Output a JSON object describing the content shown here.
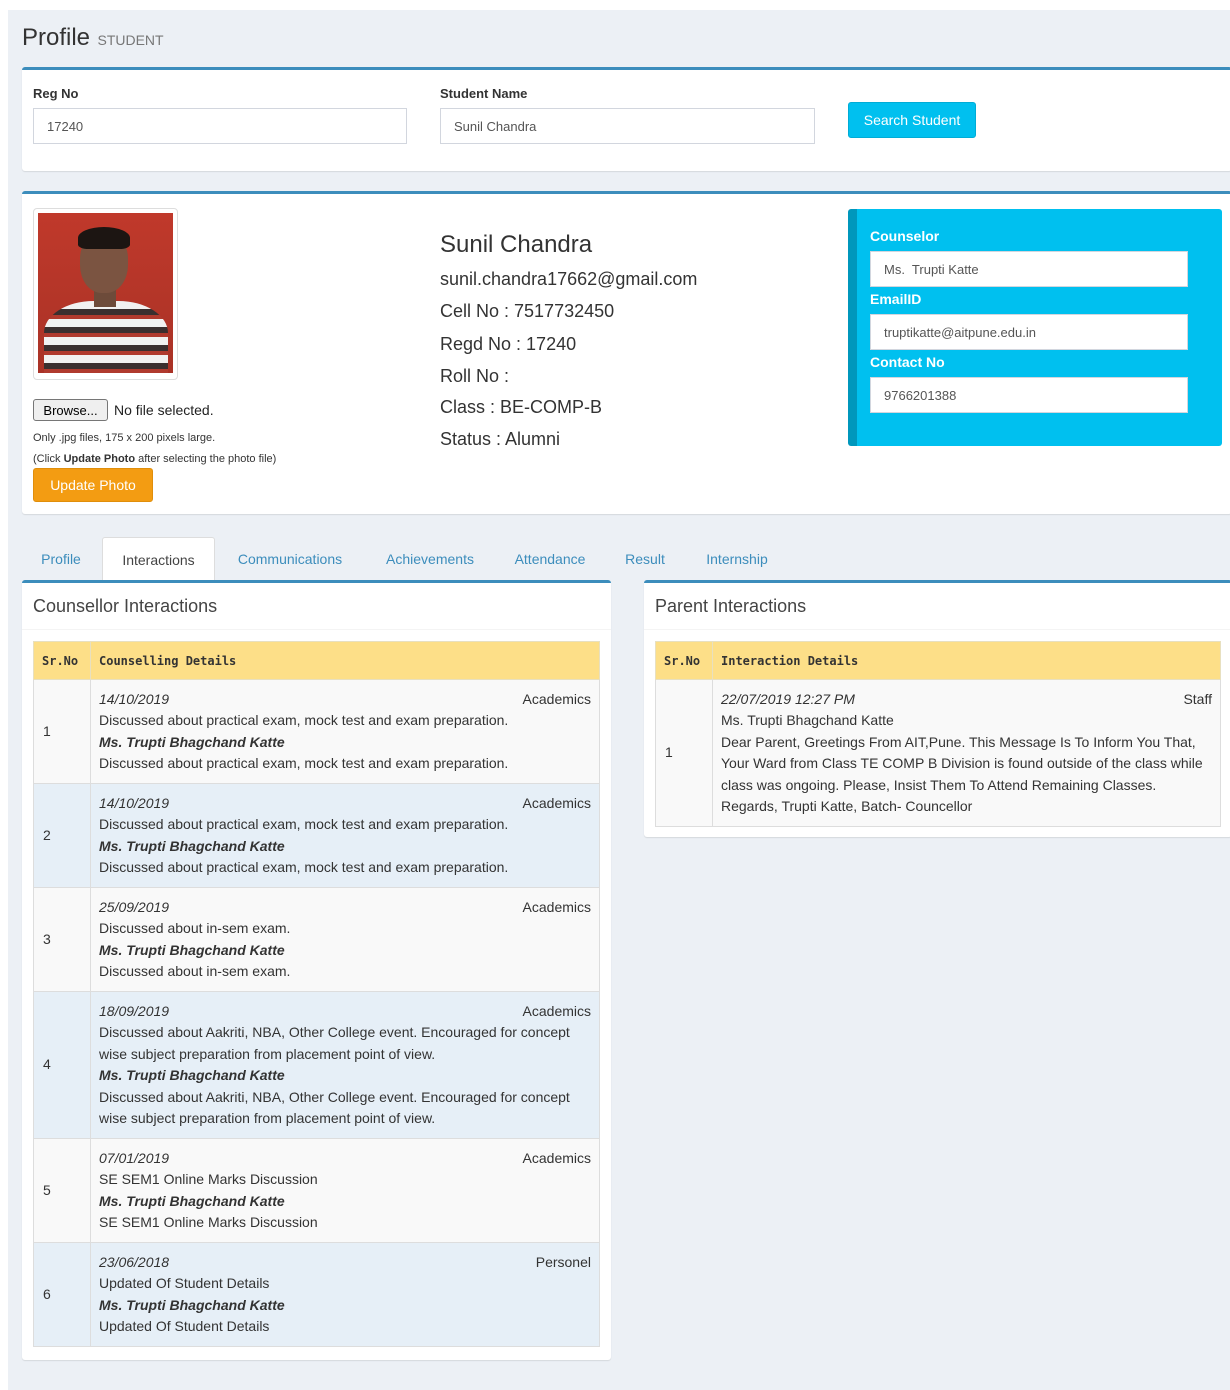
{
  "page": {
    "title": "Profile",
    "subtitle": "STUDENT"
  },
  "search": {
    "reg_label": "Reg No",
    "reg_value": "17240",
    "name_label": "Student Name",
    "name_value": "Sunil Chandra",
    "button": "Search Student"
  },
  "profile": {
    "photo_alt": "student-photo",
    "browse_label": "Browse...",
    "file_status": "No file selected.",
    "help1": "Only .jpg files, 175 x 200 pixels large.",
    "help2_pre": "(Click ",
    "help2_bold": "Update Photo",
    "help2_post": " after selecting the photo file)",
    "update_button": "Update Photo",
    "name": "Sunil Chandra",
    "email": "sunil.chandra17662@gmail.com",
    "cell": "Cell No : 7517732450",
    "regd": "Regd No : 17240",
    "roll": "Roll No :",
    "class": "Class : BE-COMP-B",
    "status": "Status : Alumni"
  },
  "counselor": {
    "counselor_label": "Counselor",
    "counselor_value": "Ms.  Trupti Katte",
    "email_label": "EmailID",
    "email_value": "truptikatte@aitpune.edu.in",
    "contact_label": "Contact No",
    "contact_value": "9766201388"
  },
  "tabs": [
    "Profile",
    "Interactions",
    "Communications",
    "Achievements",
    "Attendance",
    "Result",
    "Internship"
  ],
  "counsellor_interactions": {
    "title": "Counsellor Interactions",
    "headers": [
      "Sr.No",
      "Counselling Details"
    ],
    "rows": [
      {
        "sr": "1",
        "date": "14/10/2019",
        "category": "Academics",
        "details": "Discussed about practical exam, mock test and exam preparation.",
        "by": "Ms. Trupti Bhagchand Katte",
        "note": "Discussed about practical exam, mock test and exam preparation."
      },
      {
        "sr": "2",
        "date": "14/10/2019",
        "category": "Academics",
        "details": "Discussed about practical exam, mock test and exam preparation.",
        "by": "Ms. Trupti Bhagchand Katte",
        "note": "Discussed about practical exam, mock test and exam preparation."
      },
      {
        "sr": "3",
        "date": "25/09/2019",
        "category": "Academics",
        "details": "Discussed about in-sem exam.",
        "by": "Ms. Trupti Bhagchand Katte",
        "note": "Discussed about in-sem exam."
      },
      {
        "sr": "4",
        "date": "18/09/2019",
        "category": "Academics",
        "details": "Discussed about Aakriti, NBA, Other College event. Encouraged for concept wise subject preparation from placement point of view.",
        "by": "Ms. Trupti Bhagchand Katte",
        "note": "Discussed about Aakriti, NBA, Other College event. Encouraged for concept wise subject preparation from placement point of view."
      },
      {
        "sr": "5",
        "date": "07/01/2019",
        "category": "Academics",
        "details": "SE SEM1 Online Marks Discussion",
        "by": "Ms. Trupti Bhagchand Katte",
        "note": "SE SEM1 Online Marks Discussion"
      },
      {
        "sr": "6",
        "date": "23/06/2018",
        "category": "Personel",
        "details": "Updated Of Student Details",
        "by": "Ms. Trupti Bhagchand Katte",
        "note": "Updated Of Student Details"
      }
    ]
  },
  "parent_interactions": {
    "title": "Parent Interactions",
    "headers": [
      "Sr.No",
      "Interaction Details"
    ],
    "rows": [
      {
        "sr": "1",
        "date": "22/07/2019 12:27 PM",
        "category": "Staff",
        "by": "Ms. Trupti Bhagchand Katte",
        "message": "Dear Parent, Greetings From AIT,Pune. This Message Is To Inform You That, Your Ward from Class TE COMP B Division is found outside of the class while class was ongoing. Please, Insist Them To Attend Remaining Classes. Regards, Trupti Katte, Batch- Councellor"
      }
    ]
  }
}
